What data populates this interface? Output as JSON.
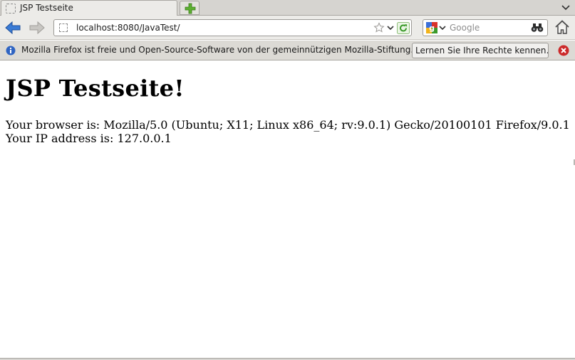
{
  "tabs": [
    {
      "title": "JSP Testseite",
      "icon": "blank-page-icon",
      "active": true
    }
  ],
  "toolbar": {
    "back_icon": "back-arrow-icon",
    "forward_icon": "forward-arrow-icon",
    "url": "localhost:8080/JavaTest/",
    "search": {
      "engine": "google-icon",
      "placeholder": "Google"
    },
    "home_icon": "home-icon"
  },
  "notification": {
    "message": "Mozilla Firefox ist freie und Open-Source-Software von der gemeinnützigen Mozilla-Stiftung.",
    "button_label": "Lernen Sie Ihre Rechte kennen…"
  },
  "page": {
    "heading": "JSP Testseite!",
    "browser_line": "Your browser is: Mozilla/5.0 (Ubuntu; X11; Linux x86_64; rv:9.0.1) Gecko/20100101 Firefox/9.0.1",
    "ip_line": "Your IP address is: 127.0.0.1"
  },
  "colors": {
    "chrome": "#ecebe8",
    "notification_bg": "#dcdad5",
    "back_arrow": "#3a7bd5",
    "reload": "#3a9a2a",
    "close_red": "#cc2a2a"
  }
}
